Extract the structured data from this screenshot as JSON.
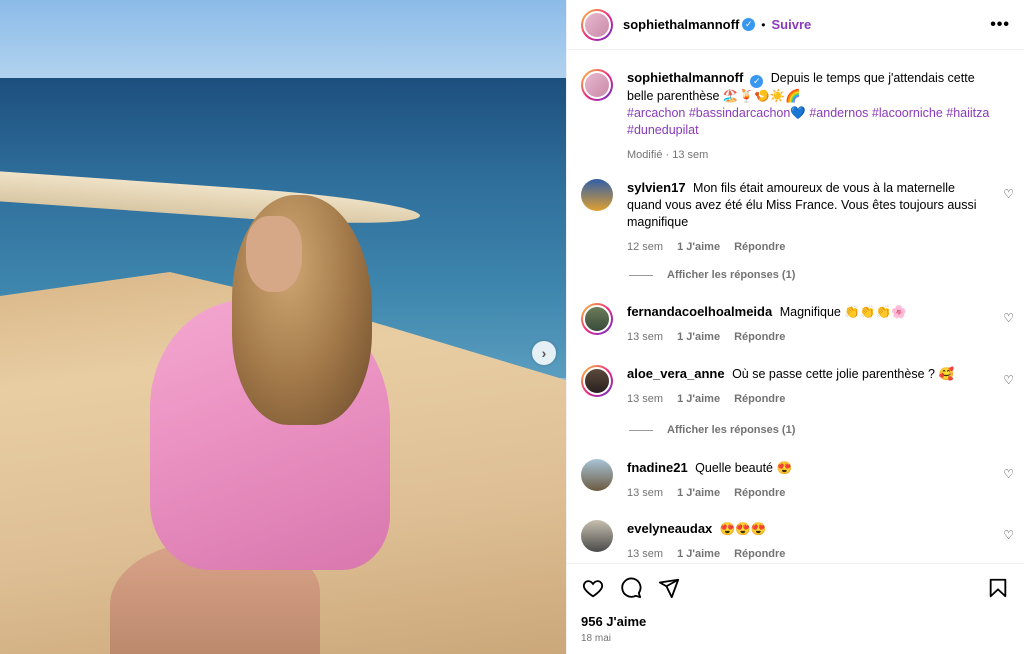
{
  "post": {
    "author": "sophiethalmannoff",
    "follow_label": "Suivre",
    "more_label": "•••",
    "dot": "•",
    "caption_text": "Depuis le temps que j'attendais cette belle parenthèse 🏖️🍹🍤☀️🌈",
    "hashtags": "#arcachon #bassindarcachon💙 #andernos #lacoorniche #haiitza #dunedupilat",
    "caption_meta": "Modifié · 13 sem",
    "likes": "956 J'aime",
    "date": "18 mai"
  },
  "comments": [
    {
      "user": "sylvien17",
      "text": "Mon fils était amoureux de vous à la maternelle quand vous avez été élu Miss France. Vous êtes toujours aussi magnifique",
      "time": "12 sem",
      "likes": "1 J'aime",
      "reply": "Répondre",
      "view_replies": "Afficher les réponses (1)"
    },
    {
      "user": "fernandacoelhoalmeida",
      "text": "Magnifique 👏👏👏🌸",
      "time": "13 sem",
      "likes": "1 J'aime",
      "reply": "Répondre"
    },
    {
      "user": "aloe_vera_anne",
      "text": "Où se passe cette jolie parenthèse ? 🥰",
      "time": "13 sem",
      "likes": "1 J'aime",
      "reply": "Répondre",
      "view_replies": "Afficher les réponses (1)"
    },
    {
      "user": "fnadine21",
      "text": "Quelle beauté 😍",
      "time": "13 sem",
      "likes": "1 J'aime",
      "reply": "Répondre"
    },
    {
      "user": "evelyneaudax",
      "text": "😍😍😍",
      "time": "13 sem",
      "likes": "1 J'aime",
      "reply": "Répondre"
    }
  ],
  "icons": {
    "verified": "✓",
    "heart": "♡",
    "next": "›"
  },
  "colors": {
    "accent": "#8a3ab9",
    "verified": "#3897f0",
    "muted": "#737373"
  }
}
